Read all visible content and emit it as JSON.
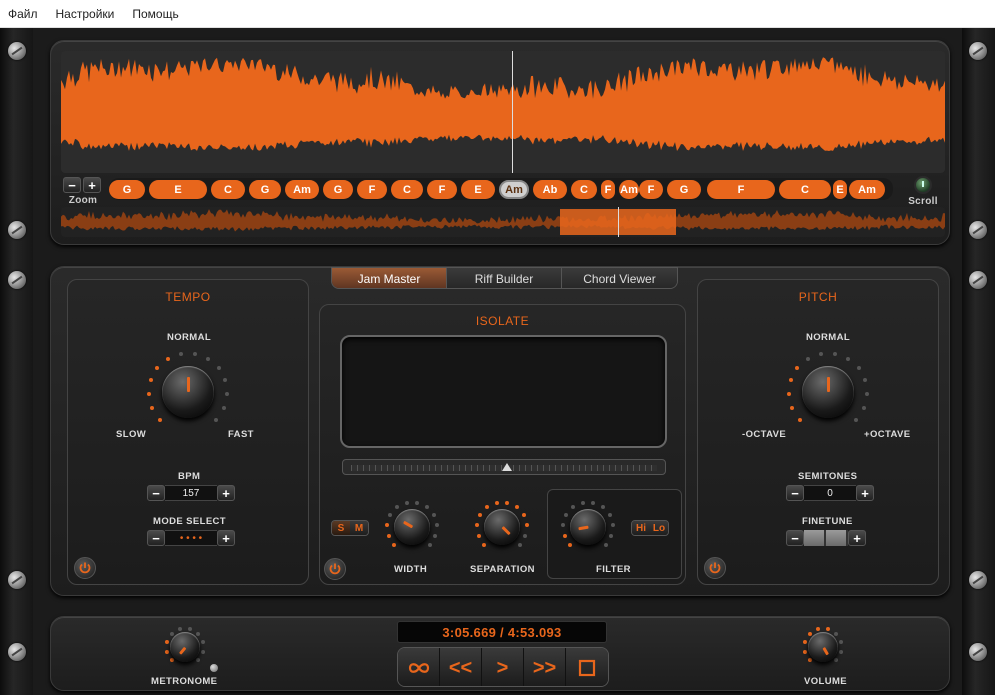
{
  "menu": {
    "file": "Файл",
    "settings": "Настройки",
    "help": "Помощь"
  },
  "colors": {
    "accent": "#e8661c",
    "panel": "#1d1d1d"
  },
  "waveform": {
    "zoom_label": "Zoom",
    "scroll_label": "Scroll",
    "zoom_minus": "−",
    "zoom_plus": "+",
    "chords": [
      "G",
      "E",
      "C",
      "G",
      "Am",
      "G",
      "F",
      "C",
      "F",
      "E",
      "Am",
      "Ab",
      "C",
      "F",
      "Am",
      "F",
      "G",
      "F",
      "C",
      "E",
      "Am"
    ],
    "selected_chord_index": 10
  },
  "tabs": [
    {
      "label": "Jam Master",
      "active": true
    },
    {
      "label": "Riff Builder",
      "active": false
    },
    {
      "label": "Chord Viewer",
      "active": false
    }
  ],
  "tempo": {
    "title": "TEMPO",
    "normal": "NORMAL",
    "slow": "SLOW",
    "fast": "FAST",
    "bpm_label": "BPM",
    "bpm_value": "157",
    "mode_label": "MODE SELECT",
    "mode_value": "• • • •",
    "minus": "−",
    "plus": "+"
  },
  "isolate": {
    "title": "ISOLATE",
    "s": "S",
    "m": "M",
    "width": "WIDTH",
    "separation": "SEPARATION",
    "filter": "FILTER",
    "hi": "Hi",
    "lo": "Lo"
  },
  "pitch": {
    "title": "PITCH",
    "normal": "NORMAL",
    "minus_octave": "-OCTAVE",
    "plus_octave": "+OCTAVE",
    "semitones_label": "SEMITONES",
    "semitones_value": "0",
    "finetune_label": "FINETUNE",
    "minus": "−",
    "plus": "+"
  },
  "transport": {
    "time": "3:05.669 / 4:53.093",
    "metronome": "METRONOME",
    "volume": "VOLUME",
    "rewind": "<<",
    "play": ">",
    "forward": ">>"
  }
}
